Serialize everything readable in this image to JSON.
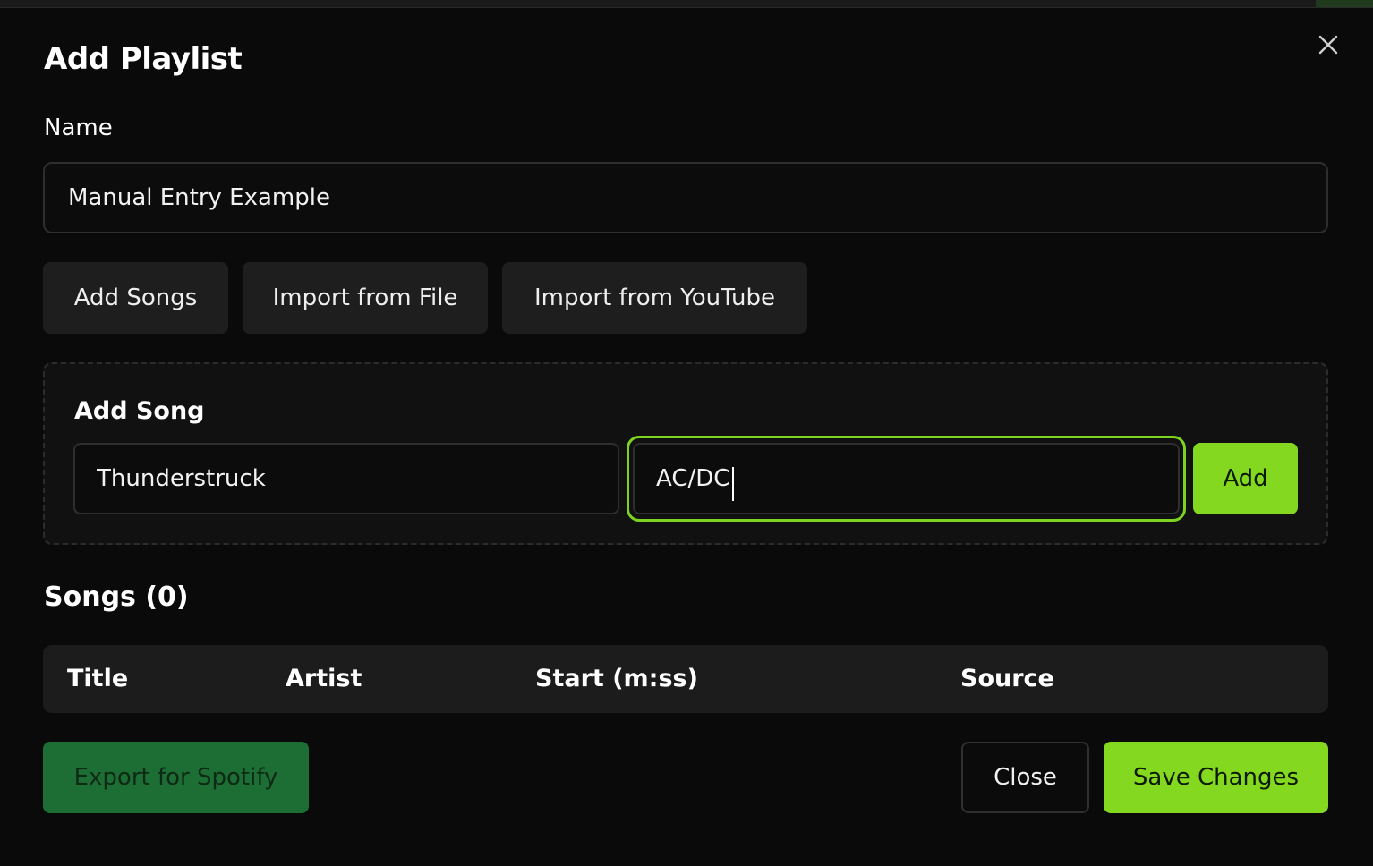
{
  "dialog": {
    "title": "Add Playlist"
  },
  "name_field": {
    "label": "Name",
    "value": "Manual Entry Example"
  },
  "tabs": [
    {
      "label": "Add Songs"
    },
    {
      "label": "Import from File"
    },
    {
      "label": "Import from YouTube"
    }
  ],
  "add_song": {
    "label": "Add Song",
    "title_value": "Thunderstruck",
    "artist_value": "AC/DC",
    "add_label": "Add"
  },
  "songs": {
    "heading": "Songs (0)",
    "columns": [
      "Title",
      "Artist",
      "Start (m:ss)",
      "Source"
    ]
  },
  "footer": {
    "export_label": "Export for Spotify",
    "close_label": "Close",
    "save_label": "Save Changes"
  },
  "icons": {
    "close": "close-icon"
  },
  "colors": {
    "accent": "#84d81f",
    "spotify": "#1d6e34",
    "background": "#0a0a0a"
  }
}
